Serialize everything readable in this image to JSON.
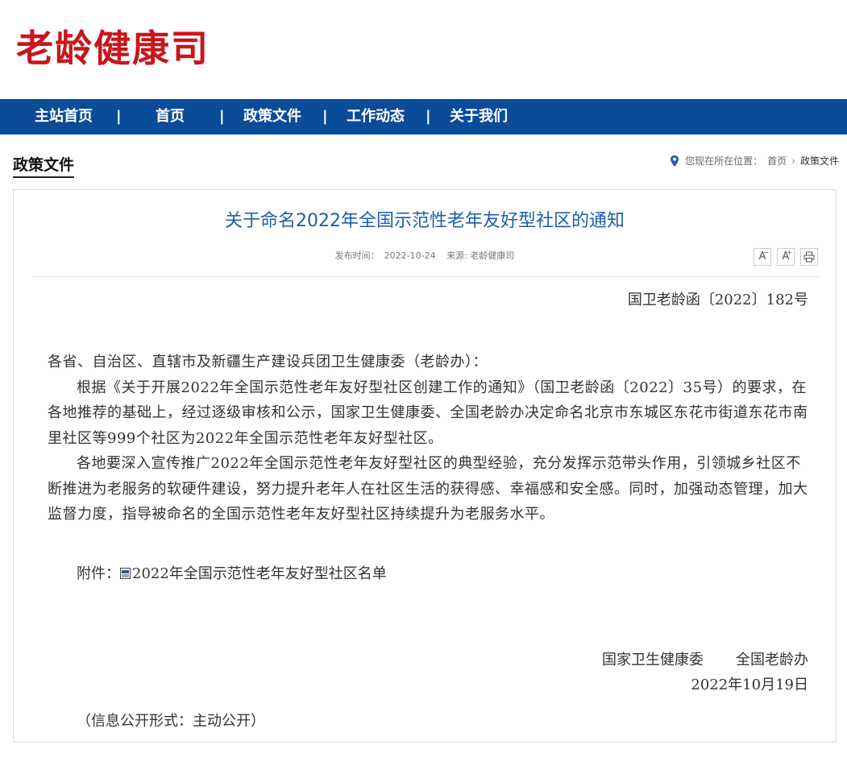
{
  "site": {
    "logo": "老龄健康司"
  },
  "nav": {
    "items": [
      "主站首页",
      "首页",
      "政策文件",
      "工作动态",
      "关于我们"
    ],
    "separator": "|"
  },
  "section": {
    "title": "政策文件"
  },
  "breadcrumb": {
    "prefix": "您现在所在位置：",
    "home": "首页",
    "arrow": "›",
    "current": "政策文件"
  },
  "article": {
    "title": "关于命名2022年全国示范性老年友好型社区的通知",
    "publish_label": "发布时间：",
    "publish_date": "2022-10-24",
    "source_label": "来源: 老龄健康司",
    "tools": {
      "font_smaller": "A",
      "font_larger": "A",
      "print_icon": "printer-icon"
    },
    "doc_number": "国卫老龄函〔2022〕182号",
    "addressee": "各省、自治区、直辖市及新疆生产建设兵团卫生健康委（老龄办）：",
    "paragraphs": [
      "根据《关于开展2022年全国示范性老年友好型社区创建工作的通知》（国卫老龄函〔2022〕35号）的要求，在各地推荐的基础上，经过逐级审核和公示，国家卫生健康委、全国老龄办决定命名北京市东城区东花市街道东花市南里社区等999个社区为2022年全国示范性老年友好型社区。",
      "各地要深入宣传推广2022年全国示范性老年友好型社区的典型经验，充分发挥示范带头作用，引领城乡社区不断推进为老服务的软硬件建设，努力提升老年人在社区生活的获得感、幸福感和安全感。同时，加强动态管理，加大监督力度，指导被命名的全国示范性老年友好型社区持续提升为老服务水平。"
    ],
    "attachment_label": "附件：",
    "attachment_name": "2022年全国示范性老年友好型社区名单",
    "signatories": [
      "国家卫生健康委",
      "全国老龄办"
    ],
    "sign_date": "2022年10月19日",
    "disclosure": "（信息公开形式：主动公开）"
  },
  "colors": {
    "brand_red": "#c8161d",
    "nav_blue": "#0b4c98",
    "title_blue": "#1e5ea8"
  }
}
